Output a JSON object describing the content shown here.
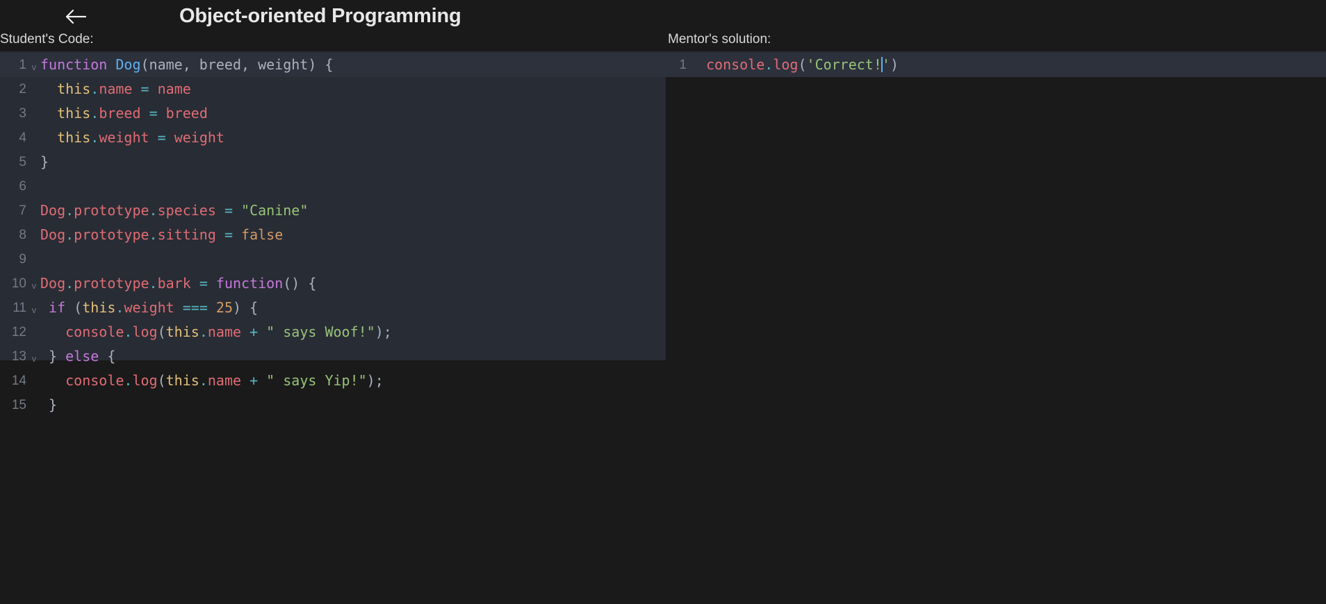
{
  "header": {
    "back_icon": "arrow-left-icon",
    "title": "Object-oriented Programming"
  },
  "colors": {
    "page_background": "#1a1a1a",
    "editor_background": "#282c34",
    "active_line": "#2c313c",
    "keyword": "#c678dd",
    "class_name": "#61afef",
    "this_keyword": "#e5c07b",
    "property": "#e06c75",
    "operator": "#56b6c2",
    "string": "#98c379",
    "number": "#d19a66",
    "plain_text": "#abb2bf",
    "line_number": "#737a86",
    "title_text": "#e8e8e8"
  },
  "student": {
    "label": "Student's Code:",
    "lines": [
      {
        "num": "1",
        "fold": "v",
        "active": true,
        "tokens": [
          {
            "t": "function",
            "c": "t-kw"
          },
          {
            "t": " ",
            "c": "t-plain"
          },
          {
            "t": "Dog",
            "c": "t-cls"
          },
          {
            "t": "(name, breed, weight) {",
            "c": "t-plain"
          }
        ]
      },
      {
        "num": "2",
        "fold": "",
        "active": false,
        "tokens": [
          {
            "t": "  ",
            "c": "t-plain"
          },
          {
            "t": "this",
            "c": "t-this"
          },
          {
            "t": ".",
            "c": "t-op"
          },
          {
            "t": "name",
            "c": "t-prop"
          },
          {
            "t": " ",
            "c": "t-plain"
          },
          {
            "t": "=",
            "c": "t-op"
          },
          {
            "t": " ",
            "c": "t-plain"
          },
          {
            "t": "name",
            "c": "t-prop"
          }
        ]
      },
      {
        "num": "3",
        "fold": "",
        "active": false,
        "tokens": [
          {
            "t": "  ",
            "c": "t-plain"
          },
          {
            "t": "this",
            "c": "t-this"
          },
          {
            "t": ".",
            "c": "t-op"
          },
          {
            "t": "breed",
            "c": "t-prop"
          },
          {
            "t": " ",
            "c": "t-plain"
          },
          {
            "t": "=",
            "c": "t-op"
          },
          {
            "t": " ",
            "c": "t-plain"
          },
          {
            "t": "breed",
            "c": "t-prop"
          }
        ]
      },
      {
        "num": "4",
        "fold": "",
        "active": false,
        "tokens": [
          {
            "t": "  ",
            "c": "t-plain"
          },
          {
            "t": "this",
            "c": "t-this"
          },
          {
            "t": ".",
            "c": "t-op"
          },
          {
            "t": "weight",
            "c": "t-prop"
          },
          {
            "t": " ",
            "c": "t-plain"
          },
          {
            "t": "=",
            "c": "t-op"
          },
          {
            "t": " ",
            "c": "t-plain"
          },
          {
            "t": "weight",
            "c": "t-prop"
          }
        ]
      },
      {
        "num": "5",
        "fold": "",
        "active": false,
        "tokens": [
          {
            "t": "}",
            "c": "t-plain"
          }
        ]
      },
      {
        "num": "6",
        "fold": "",
        "active": false,
        "tokens": []
      },
      {
        "num": "7",
        "fold": "",
        "active": false,
        "tokens": [
          {
            "t": "Dog",
            "c": "t-prop"
          },
          {
            "t": ".",
            "c": "t-op"
          },
          {
            "t": "prototype",
            "c": "t-prop"
          },
          {
            "t": ".",
            "c": "t-op"
          },
          {
            "t": "species",
            "c": "t-prop"
          },
          {
            "t": " ",
            "c": "t-plain"
          },
          {
            "t": "=",
            "c": "t-op"
          },
          {
            "t": " ",
            "c": "t-plain"
          },
          {
            "t": "\"Canine\"",
            "c": "t-str"
          }
        ]
      },
      {
        "num": "8",
        "fold": "",
        "active": false,
        "tokens": [
          {
            "t": "Dog",
            "c": "t-prop"
          },
          {
            "t": ".",
            "c": "t-op"
          },
          {
            "t": "prototype",
            "c": "t-prop"
          },
          {
            "t": ".",
            "c": "t-op"
          },
          {
            "t": "sitting",
            "c": "t-prop"
          },
          {
            "t": " ",
            "c": "t-plain"
          },
          {
            "t": "=",
            "c": "t-op"
          },
          {
            "t": " ",
            "c": "t-plain"
          },
          {
            "t": "false",
            "c": "t-num"
          }
        ]
      },
      {
        "num": "9",
        "fold": "",
        "active": false,
        "tokens": []
      },
      {
        "num": "10",
        "fold": "v",
        "active": false,
        "tokens": [
          {
            "t": "Dog",
            "c": "t-prop"
          },
          {
            "t": ".",
            "c": "t-op"
          },
          {
            "t": "prototype",
            "c": "t-prop"
          },
          {
            "t": ".",
            "c": "t-op"
          },
          {
            "t": "bark",
            "c": "t-prop"
          },
          {
            "t": " ",
            "c": "t-plain"
          },
          {
            "t": "=",
            "c": "t-op"
          },
          {
            "t": " ",
            "c": "t-plain"
          },
          {
            "t": "function",
            "c": "t-kw"
          },
          {
            "t": "() {",
            "c": "t-plain"
          }
        ]
      },
      {
        "num": "11",
        "fold": "v",
        "active": false,
        "tokens": [
          {
            "t": " ",
            "c": "t-plain"
          },
          {
            "t": "if",
            "c": "t-kw"
          },
          {
            "t": " (",
            "c": "t-plain"
          },
          {
            "t": "this",
            "c": "t-this"
          },
          {
            "t": ".",
            "c": "t-op"
          },
          {
            "t": "weight",
            "c": "t-prop"
          },
          {
            "t": " ",
            "c": "t-plain"
          },
          {
            "t": "===",
            "c": "t-op"
          },
          {
            "t": " ",
            "c": "t-plain"
          },
          {
            "t": "25",
            "c": "t-num"
          },
          {
            "t": ") {",
            "c": "t-plain"
          }
        ]
      },
      {
        "num": "12",
        "fold": "",
        "active": false,
        "tokens": [
          {
            "t": "   ",
            "c": "t-plain"
          },
          {
            "t": "console",
            "c": "t-prop"
          },
          {
            "t": ".",
            "c": "t-op"
          },
          {
            "t": "log",
            "c": "t-prop"
          },
          {
            "t": "(",
            "c": "t-plain"
          },
          {
            "t": "this",
            "c": "t-this"
          },
          {
            "t": ".",
            "c": "t-op"
          },
          {
            "t": "name",
            "c": "t-prop"
          },
          {
            "t": " ",
            "c": "t-plain"
          },
          {
            "t": "+",
            "c": "t-op"
          },
          {
            "t": " ",
            "c": "t-plain"
          },
          {
            "t": "\" says Woof!\"",
            "c": "t-str"
          },
          {
            "t": ");",
            "c": "t-plain"
          }
        ]
      },
      {
        "num": "13",
        "fold": "v",
        "active": false,
        "tokens": [
          {
            "t": " } ",
            "c": "t-plain"
          },
          {
            "t": "else",
            "c": "t-kw"
          },
          {
            "t": " {",
            "c": "t-plain"
          }
        ]
      },
      {
        "num": "14",
        "fold": "",
        "active": false,
        "tokens": [
          {
            "t": "   ",
            "c": "t-plain"
          },
          {
            "t": "console",
            "c": "t-prop"
          },
          {
            "t": ".",
            "c": "t-op"
          },
          {
            "t": "log",
            "c": "t-prop"
          },
          {
            "t": "(",
            "c": "t-plain"
          },
          {
            "t": "this",
            "c": "t-this"
          },
          {
            "t": ".",
            "c": "t-op"
          },
          {
            "t": "name",
            "c": "t-prop"
          },
          {
            "t": " ",
            "c": "t-plain"
          },
          {
            "t": "+",
            "c": "t-op"
          },
          {
            "t": " ",
            "c": "t-plain"
          },
          {
            "t": "\" says Yip!\"",
            "c": "t-str"
          },
          {
            "t": ");",
            "c": "t-plain"
          }
        ]
      },
      {
        "num": "15",
        "fold": "",
        "active": false,
        "tokens": [
          {
            "t": " }",
            "c": "t-plain"
          }
        ]
      }
    ]
  },
  "mentor": {
    "label": "Mentor's solution:",
    "lines": [
      {
        "num": "1",
        "fold": "",
        "active": true,
        "caret_after": 5,
        "tokens": [
          {
            "t": "console",
            "c": "t-prop"
          },
          {
            "t": ".",
            "c": "t-op"
          },
          {
            "t": "log",
            "c": "t-prop"
          },
          {
            "t": "(",
            "c": "t-plain"
          },
          {
            "t": "'",
            "c": "t-str"
          },
          {
            "t": "Correct!",
            "c": "t-str"
          },
          {
            "t": "'",
            "c": "t-str"
          },
          {
            "t": ")",
            "c": "t-plain"
          }
        ]
      }
    ]
  }
}
